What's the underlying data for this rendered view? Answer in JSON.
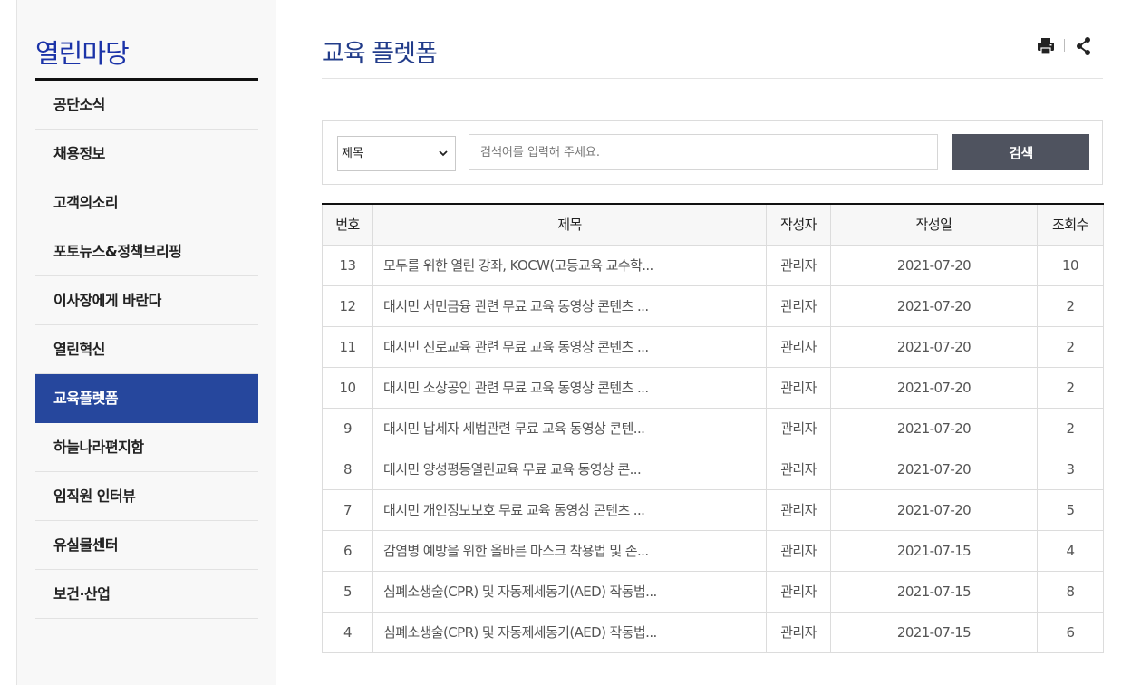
{
  "sidebar": {
    "title": "열린마당",
    "items": [
      {
        "label": "공단소식",
        "name": "sidebar-item-news"
      },
      {
        "label": "채용정보",
        "name": "sidebar-item-recruit"
      },
      {
        "label": "고객의소리",
        "name": "sidebar-item-voice"
      },
      {
        "label": "포토뉴스&정책브리핑",
        "name": "sidebar-item-photo-news"
      },
      {
        "label": "이사장에게 바란다",
        "name": "sidebar-item-chairman"
      },
      {
        "label": "열린혁신",
        "name": "sidebar-item-innovation"
      },
      {
        "label": "교육플렛폼",
        "name": "sidebar-item-education",
        "active": true
      },
      {
        "label": "하늘나라편지함",
        "name": "sidebar-item-heaven-letter"
      },
      {
        "label": "임직원 인터뷰",
        "name": "sidebar-item-interview"
      },
      {
        "label": "유실물센터",
        "name": "sidebar-item-lost-found"
      },
      {
        "label": "보건·산업",
        "name": "sidebar-item-health"
      }
    ]
  },
  "header": {
    "title": "교육 플렛폼",
    "icons": [
      "print-icon",
      "share-icon"
    ]
  },
  "search": {
    "select_value": "제목",
    "placeholder": "검색어를 입력해 주세요.",
    "button_label": "검색"
  },
  "table": {
    "headers": [
      "번호",
      "제목",
      "작성자",
      "작성일",
      "조회수"
    ],
    "rows": [
      {
        "no": "13",
        "title": "모두를 위한 열린 강좌, KOCW(고등교육 교수학...",
        "author": "관리자",
        "date": "2021-07-20",
        "views": "10"
      },
      {
        "no": "12",
        "title": "대시민 서민금융 관련 무료 교육 동영상 콘텐츠 ...",
        "author": "관리자",
        "date": "2021-07-20",
        "views": "2"
      },
      {
        "no": "11",
        "title": "대시민 진로교육 관련 무료 교육 동영상 콘텐츠 ...",
        "author": "관리자",
        "date": "2021-07-20",
        "views": "2"
      },
      {
        "no": "10",
        "title": "대시민 소상공인 관련 무료 교육 동영상 콘텐츠 ...",
        "author": "관리자",
        "date": "2021-07-20",
        "views": "2"
      },
      {
        "no": "9",
        "title": "대시민 납세자 세법관련 무료 교육 동영상 콘텐...",
        "author": "관리자",
        "date": "2021-07-20",
        "views": "2"
      },
      {
        "no": "8",
        "title": "대시민 양성평등열린교육 무료 교육 동영상 콘...",
        "author": "관리자",
        "date": "2021-07-20",
        "views": "3"
      },
      {
        "no": "7",
        "title": "대시민 개인정보보호 무료 교육 동영상 콘텐츠 ...",
        "author": "관리자",
        "date": "2021-07-20",
        "views": "5"
      },
      {
        "no": "6",
        "title": "감염병 예방을 위한 올바른 마스크 착용법 및 손...",
        "author": "관리자",
        "date": "2021-07-15",
        "views": "4"
      },
      {
        "no": "5",
        "title": "심폐소생술(CPR) 및 자동제세동기(AED) 작동법...",
        "author": "관리자",
        "date": "2021-07-15",
        "views": "8"
      },
      {
        "no": "4",
        "title": "심폐소생술(CPR) 및 자동제세동기(AED) 작동법...",
        "author": "관리자",
        "date": "2021-07-15",
        "views": "6"
      }
    ]
  },
  "colors": {
    "brand_blue": "#1b33a8",
    "active_menu": "#26479d",
    "search_button": "#4f535f"
  }
}
